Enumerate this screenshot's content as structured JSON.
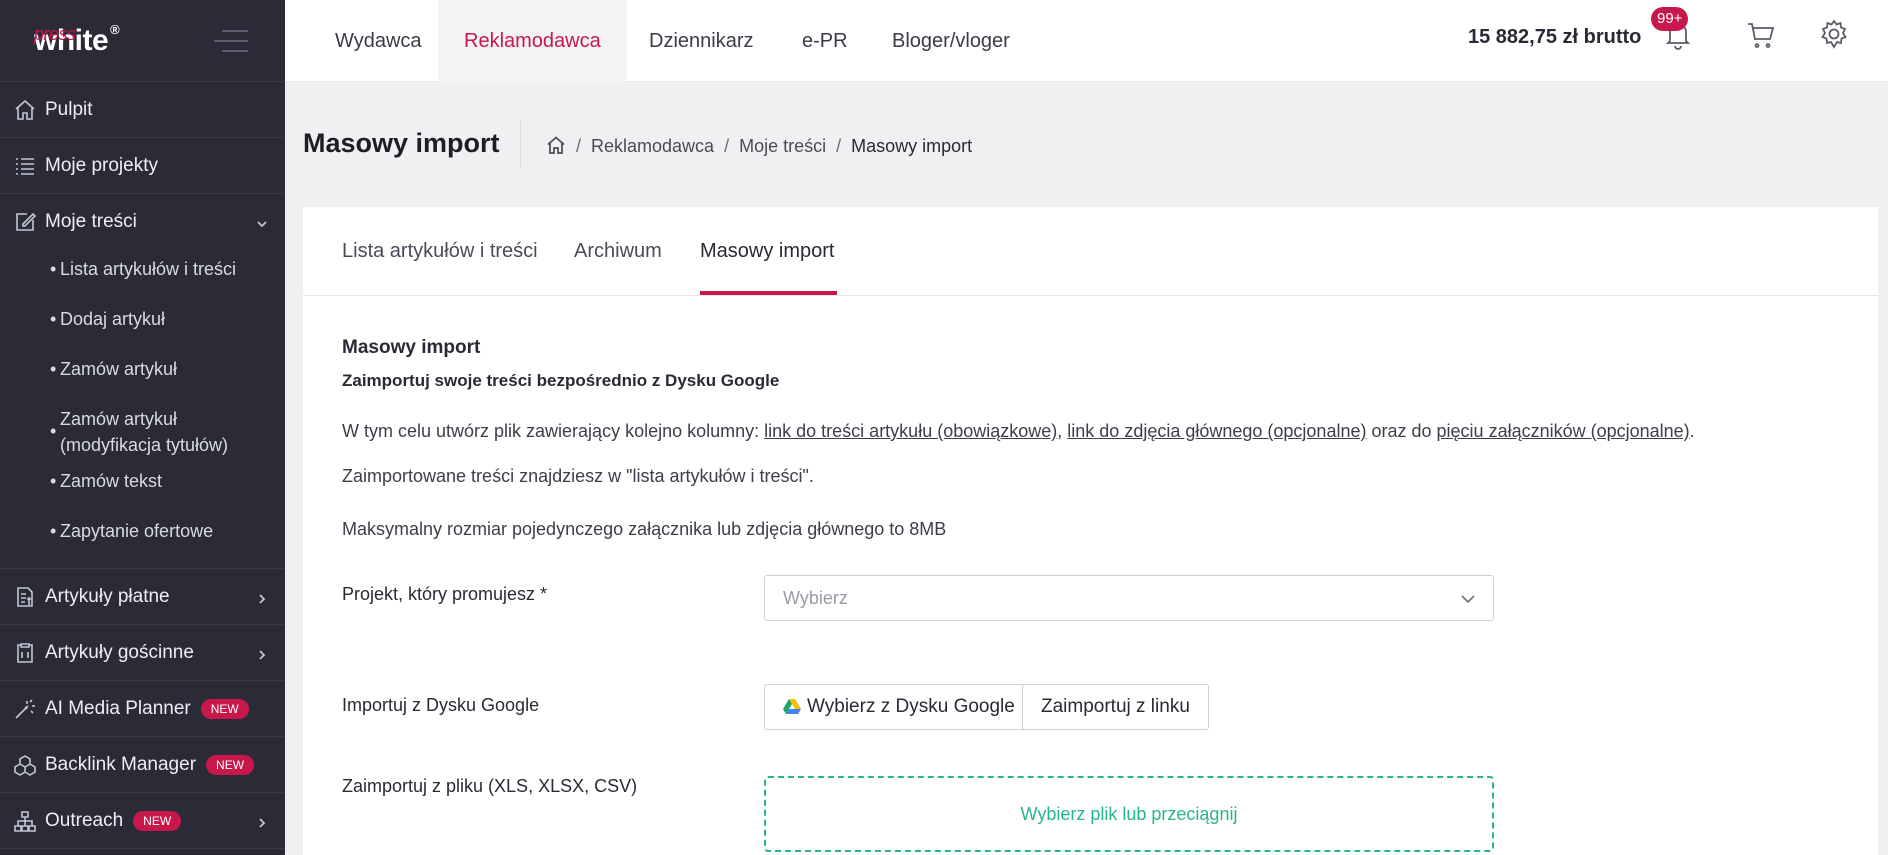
{
  "brand": {
    "name_white": "white",
    "name_press": "press",
    "reg": "®"
  },
  "sidebar": {
    "items": [
      {
        "label": "Pulpit",
        "icon": "home-icon"
      },
      {
        "label": "Moje projekty",
        "icon": "list-icon"
      },
      {
        "label": "Moje treści",
        "icon": "edit-icon",
        "expanded": true,
        "children": [
          "Lista artykułów i treści",
          "Dodaj artykuł",
          "Zamów artykuł",
          "Zamów artykuł (modyfikacja tytułów)",
          "Zamów tekst",
          "Zapytanie ofertowe"
        ]
      },
      {
        "label": "Artykuły płatne",
        "icon": "paid-article-icon"
      },
      {
        "label": "Artykuły gościnne",
        "icon": "clipboard-icon"
      },
      {
        "label": "AI Media Planner",
        "icon": "wand-icon",
        "badge": "NEW"
      },
      {
        "label": "Backlink Manager",
        "icon": "cubes-icon",
        "badge": "NEW"
      },
      {
        "label": "Outreach",
        "icon": "hierarchy-icon",
        "badge": "NEW"
      }
    ]
  },
  "topbar": {
    "tabs": [
      "Wydawca",
      "Reklamodawca",
      "Dziennikarz",
      "e-PR",
      "Bloger/vloger"
    ],
    "active_tab": "Reklamodawca",
    "balance": "15 882,75 zł brutto",
    "notifications_badge": "99+"
  },
  "header": {
    "title": "Masowy import",
    "breadcrumb": [
      "Reklamodawca",
      "Moje treści",
      "Masowy import"
    ]
  },
  "tabs": {
    "items": [
      "Lista artykułów i treści",
      "Archiwum",
      "Masowy import"
    ],
    "active": "Masowy import"
  },
  "content": {
    "heading": "Masowy import",
    "subheading": "Zaimportuj swoje treści bezpośrednio z Dysku Google",
    "intro_prefix": "W tym celu utwórz plik zawierający kolejno kolumny: ",
    "link1": "link do treści artykułu (obowiązkowe)",
    "comma": ", ",
    "link2": "link do zdjęcia głównego (opcjonalne)",
    "mid": " oraz do ",
    "link3": "pięciu załączników (opcjonalne)",
    "end": ".",
    "info1": "Zaimportowane treści znajdziesz w \"lista artykułów i treści\".",
    "info2": "Maksymalny rozmiar pojedynczego załącznika lub zdjęcia głównego to 8MB",
    "project_label": "Projekt, który promujesz *",
    "project_placeholder": "Wybierz",
    "gdrive_label": "Importuj z Dysku Google",
    "gdrive_button": "Wybierz z Dysku Google",
    "link_button": "Zaimportuj z linku",
    "file_label": "Zaimportuj z pliku (XLS, XLSX, CSV)",
    "dropzone_text": "Wybierz plik lub przeciągnij"
  },
  "colors": {
    "accent": "#c8174a",
    "sidebar_bg": "#2b2b38",
    "dropzone": "#27b58f"
  }
}
